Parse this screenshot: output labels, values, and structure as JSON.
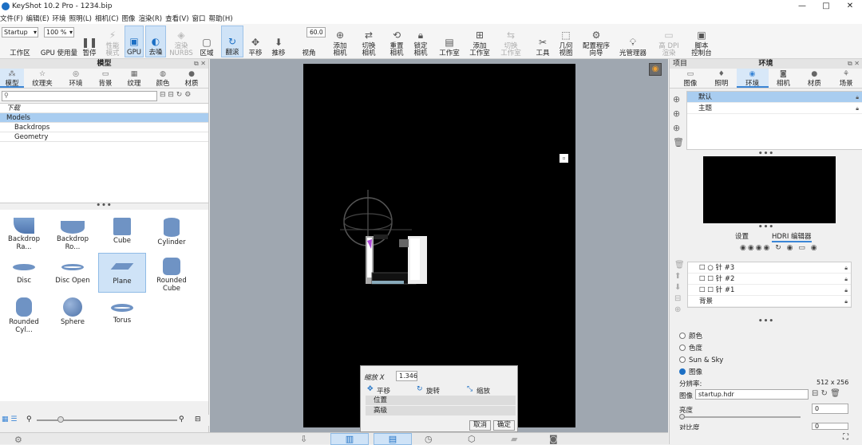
{
  "window": {
    "title": "KeyShot 10.2 Pro  - 1234.bip",
    "controls": [
      "—",
      "□",
      "✕"
    ]
  },
  "menu": [
    "文件(F)",
    "编辑(E)",
    "环境",
    "照明(L)",
    "相机(C)",
    "图像",
    "渲染(R)",
    "查看(V)",
    "窗口",
    "帮助(H)"
  ],
  "toolbar": {
    "workspace_combo": "Startup",
    "zoom_combo": "100 %",
    "fov_value": "60.0",
    "items": [
      {
        "label": "工作区",
        "icon": "workspace-icon"
      },
      {
        "label": "GPU 使用量",
        "icon": "gpu-usage-icon"
      },
      {
        "label": "暂停",
        "icon": "pause-icon"
      },
      {
        "label": "性能\n模式",
        "icon": "performance-icon"
      },
      {
        "label": "GPU",
        "icon": "gpu-icon"
      },
      {
        "label": "去噪",
        "icon": "denoise-icon"
      },
      {
        "label": "渲染\nNURBS",
        "icon": "nurbs-icon"
      },
      {
        "label": "区域",
        "icon": "region-icon"
      },
      {
        "label": "翻滚",
        "icon": "tumble-icon"
      },
      {
        "label": "平移",
        "icon": "pan-icon"
      },
      {
        "label": "推移",
        "icon": "dolly-icon"
      },
      {
        "label": "视角",
        "icon": "fov-icon"
      },
      {
        "label": "添加\n相机",
        "icon": "add-camera-icon"
      },
      {
        "label": "切换\n相机",
        "icon": "switch-camera-icon"
      },
      {
        "label": "重置\n相机",
        "icon": "reset-camera-icon"
      },
      {
        "label": "锁定\n相机",
        "icon": "lock-camera-icon"
      },
      {
        "label": "工作室",
        "icon": "studio-icon"
      },
      {
        "label": "添加\n工作室",
        "icon": "add-studio-icon"
      },
      {
        "label": "切换\n工作室",
        "icon": "switch-studio-icon"
      },
      {
        "label": "工具",
        "icon": "tools-icon"
      },
      {
        "label": "几何\n视图",
        "icon": "geometry-view-icon"
      },
      {
        "label": "配置程序\n向导",
        "icon": "configurator-icon"
      },
      {
        "label": "光管理器",
        "icon": "light-manager-icon"
      },
      {
        "label": "高 DPI\n渲染",
        "icon": "high-dpi-icon"
      },
      {
        "label": "脚本\n控制台",
        "icon": "script-console-icon"
      }
    ]
  },
  "left_panel": {
    "title": "模型",
    "tabs": [
      "模型",
      "纹理夹",
      "环境",
      "背景",
      "纹理",
      "颜色",
      "材质"
    ],
    "tree": [
      "下载",
      "Models",
      "Backdrops",
      "Geometry"
    ],
    "library": [
      "Backdrop Ra...",
      "Backdrop Ro...",
      "Cube",
      "Cylinder",
      "Disc",
      "Disc Open",
      "Plane",
      "Rounded Cube",
      "Rounded Cyl...",
      "Sphere",
      "Torus"
    ]
  },
  "right_panel": {
    "left_title": "项目",
    "title": "环境",
    "tabs": [
      "图像",
      "照明",
      "环境",
      "相机",
      "材质",
      "场景"
    ],
    "env_list": [
      "默认",
      "主题"
    ],
    "sub_tabs": [
      "设置",
      "HDRI 编辑器"
    ],
    "pins": [
      "针 #3",
      "针 #2",
      "针 #1",
      "背景"
    ],
    "bg_options": [
      "颜色",
      "色度",
      "Sun & Sky",
      "图像"
    ],
    "resolution_label": "分辨率:",
    "resolution_value": "512 x 256",
    "image_label": "图像",
    "image_file": "startup.hdr",
    "brightness_label": "亮度",
    "brightness_value": "0",
    "contrast_label": "对比度",
    "contrast_value": "0"
  },
  "transform_popup": {
    "scale_label": "缩放 X",
    "scale_value": "1.346",
    "modes": [
      "平移",
      "旋转",
      "缩放"
    ],
    "sections": [
      "位置",
      "高级"
    ],
    "cancel": "取消",
    "ok": "确定"
  },
  "colors": {
    "accent": "#3b86d6",
    "selection": "#a9cdf0",
    "viewport": "#000000",
    "workspace": "#9fa7b0"
  }
}
